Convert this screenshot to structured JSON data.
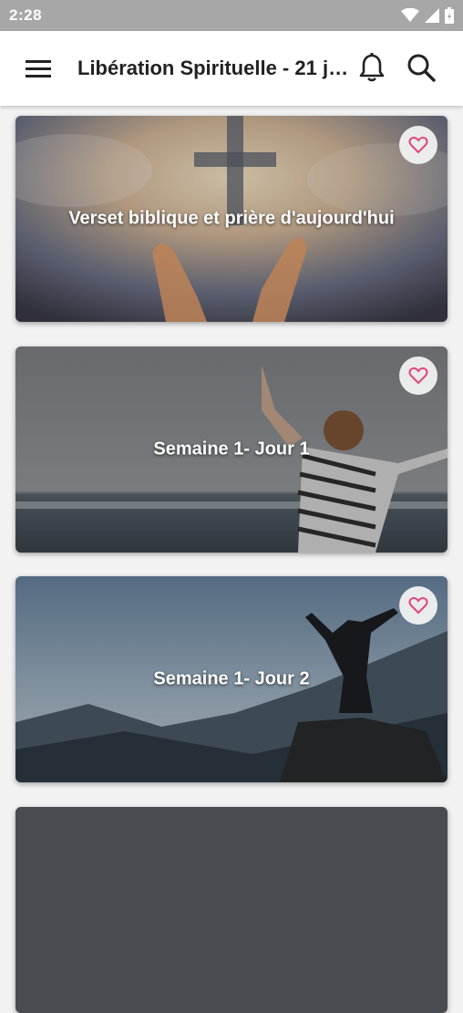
{
  "status_bar": {
    "time": "2:28"
  },
  "app_bar": {
    "title": "Libération Spirituelle - 21 jours"
  },
  "cards": [
    {
      "title": "Verset biblique et prière d'aujourd'hui"
    },
    {
      "title": "Semaine 1- Jour 1"
    },
    {
      "title": "Semaine 1- Jour 2"
    },
    {
      "title": ""
    }
  ],
  "colors": {
    "heart": "#e0457b",
    "status_bar": "#a7a7a7",
    "app_bar": "#ffffff"
  }
}
